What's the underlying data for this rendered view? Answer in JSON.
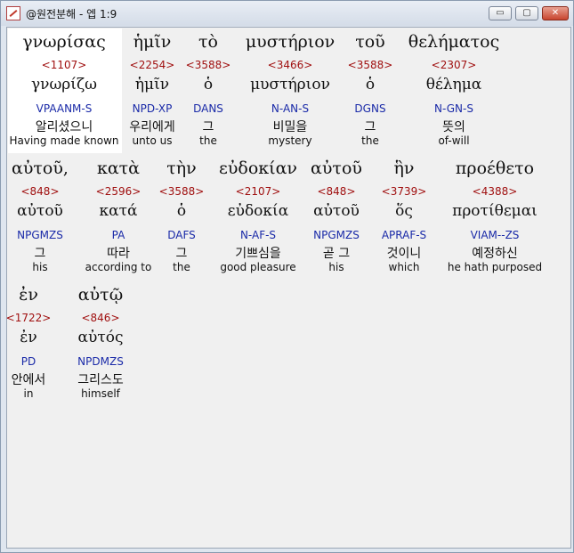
{
  "title": "@원전분해 - 엡 1:9",
  "window_buttons": {
    "minimize": "▭",
    "maximize": "▢",
    "close": "✕"
  },
  "words": [
    {
      "greek": "γνωρίσας",
      "strong": "<1107>",
      "lemma": "γνωρίζω",
      "parse": "VPAANM-S",
      "korean": "알리셨으니",
      "english": "Having made known"
    },
    {
      "greek": "ἡμῖν",
      "strong": "<2254>",
      "lemma": "ἡμῖν",
      "parse": "NPD-XP",
      "korean": "우리에게",
      "english": "unto us"
    },
    {
      "greek": "τὸ",
      "strong": "<3588>",
      "lemma": "ὁ",
      "parse": "DANS",
      "korean": "그",
      "english": "the"
    },
    {
      "greek": "μυστήριον",
      "strong": "<3466>",
      "lemma": "μυστήριον",
      "parse": "N-AN-S",
      "korean": "비밀을",
      "english": "mystery"
    },
    {
      "greek": "τοῦ",
      "strong": "<3588>",
      "lemma": "ὁ",
      "parse": "DGNS",
      "korean": "그",
      "english": "the"
    },
    {
      "greek": "θελήματος",
      "strong": "<2307>",
      "lemma": "θέλημα",
      "parse": "N-GN-S",
      "korean": "뜻의",
      "english": "of-will"
    },
    {
      "greek": "αὐτοῦ,",
      "strong": "<848>",
      "lemma": "αὐτοῦ",
      "parse": "NPGMZS",
      "korean": "그",
      "english": "his"
    },
    {
      "greek": "κατὰ",
      "strong": "<2596>",
      "lemma": "κατά",
      "parse": "PA",
      "korean": "따라",
      "english": "according to"
    },
    {
      "greek": "τὴν",
      "strong": "<3588>",
      "lemma": "ὁ",
      "parse": "DAFS",
      "korean": "그",
      "english": "the"
    },
    {
      "greek": "εὐδοκίαν",
      "strong": "<2107>",
      "lemma": "εὐδοκία",
      "parse": "N-AF-S",
      "korean": "기쁘심을",
      "english": "good pleasure"
    },
    {
      "greek": "αὐτοῦ",
      "strong": "<848>",
      "lemma": "αὐτοῦ",
      "parse": "NPGMZS",
      "korean": "곧 그",
      "english": "his"
    },
    {
      "greek": "ἣν",
      "strong": "<3739>",
      "lemma": "ὅς",
      "parse": "APRAF-S",
      "korean": "것이니",
      "english": "which"
    },
    {
      "greek": "προέθετο",
      "strong": "<4388>",
      "lemma": "προτίθεμαι",
      "parse": "VIAM--ZS",
      "korean": "예정하신",
      "english": "he hath purposed"
    },
    {
      "greek": "ἐν",
      "strong": "<1722>",
      "lemma": "ἐν",
      "parse": "PD",
      "korean": "안에서",
      "english": "in"
    },
    {
      "greek": "αὐτῷ",
      "strong": "<846>",
      "lemma": "αὐτός",
      "parse": "NPDMZS",
      "korean": "그리스도",
      "english": "himself"
    }
  ]
}
